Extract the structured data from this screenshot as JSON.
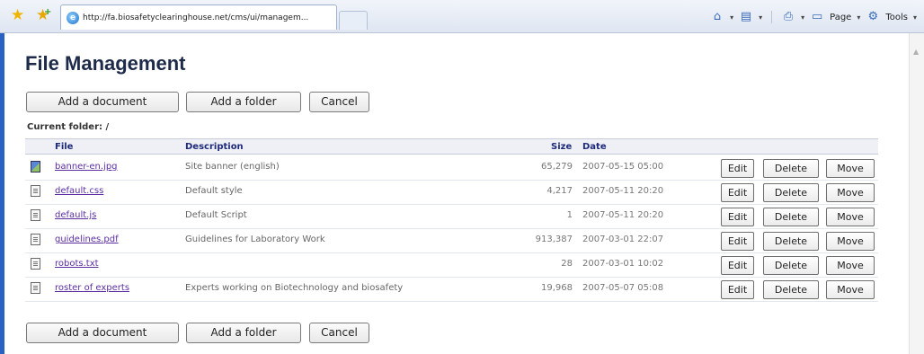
{
  "browser": {
    "tab_url": "http://fa.biosafetyclearinghouse.net/cms/ui/managem...",
    "page_label": "Page",
    "tools_label": "Tools"
  },
  "page": {
    "title": "File Management",
    "current_folder_label": "Current folder: /"
  },
  "actions": {
    "add_document": "Add a document",
    "add_folder": "Add a folder",
    "cancel": "Cancel"
  },
  "table": {
    "headers": {
      "file": "File",
      "description": "Description",
      "size": "Size",
      "date": "Date"
    },
    "row_buttons": {
      "edit": "Edit",
      "delete": "Delete",
      "move": "Move"
    },
    "rows": [
      {
        "file": "banner-en.jpg",
        "description": "Site banner (english)",
        "size": "65,279",
        "date": "2007-05-15 05:00",
        "icon": "image-file-icon"
      },
      {
        "file": "default.css",
        "description": "Default style",
        "size": "4,217",
        "date": "2007-05-11 20:20",
        "icon": "text-file-icon"
      },
      {
        "file": "default.js",
        "description": "Default Script",
        "size": "1",
        "date": "2007-05-11 20:20",
        "icon": "text-file-icon"
      },
      {
        "file": "guidelines.pdf",
        "description": "Guidelines for Laboratory Work",
        "size": "913,387",
        "date": "2007-03-01 22:07",
        "icon": "text-file-icon"
      },
      {
        "file": "robots.txt",
        "description": "",
        "size": "28",
        "date": "2007-03-01 10:02",
        "icon": "text-file-icon"
      },
      {
        "file": "roster of experts",
        "description": "Experts working on Biotechnology and biosafety",
        "size": "19,968",
        "date": "2007-05-07 05:08",
        "icon": "text-file-icon"
      }
    ]
  },
  "colors": {
    "link": "#5a2ea0",
    "header_text": "#1f2a7a",
    "frame_blue": "#2962c4"
  }
}
